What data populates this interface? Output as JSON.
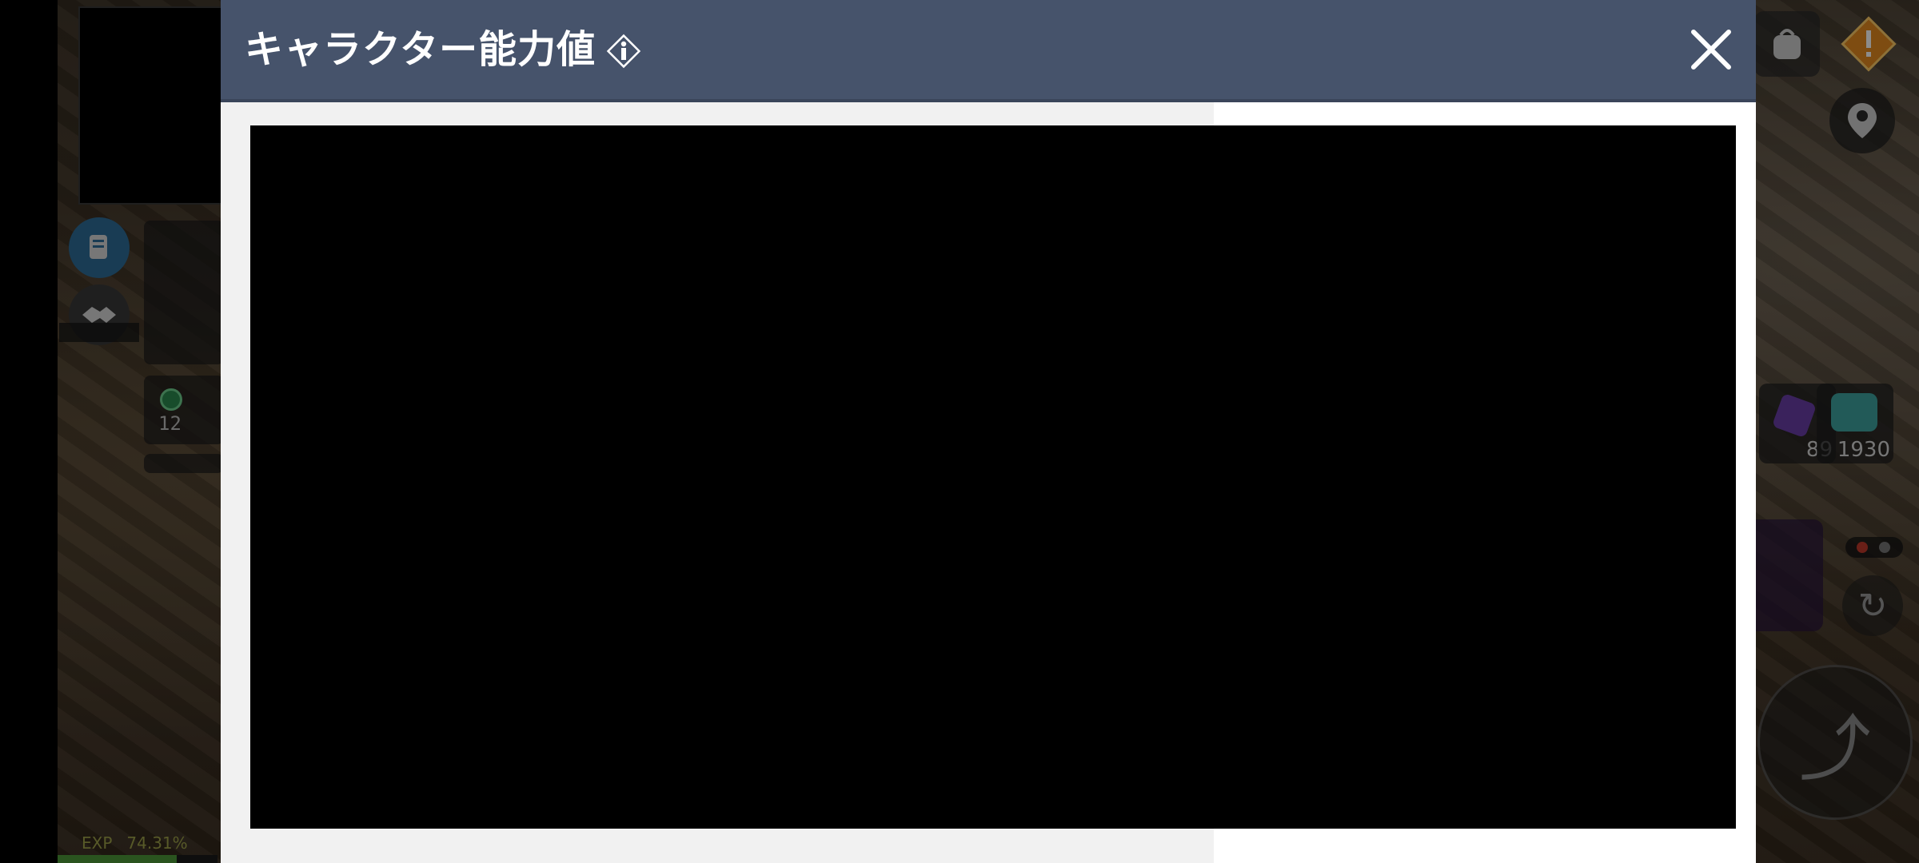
{
  "modal": {
    "title": "キャラクター能力値",
    "info_icon": "info-diamond-icon",
    "close_icon": "close-x-icon"
  },
  "hud": {
    "party": [
      {
        "level": "12"
      }
    ],
    "exp": {
      "label": "EXP",
      "percent_text": "74.31%",
      "progress": 0.7431
    },
    "items": [
      {
        "icon": "purple-crystal-icon",
        "count": "89"
      },
      {
        "icon": "potion-chest-icon",
        "count": "1930"
      }
    ],
    "icons": {
      "bag": "bag-icon",
      "warning": "warning-icon",
      "map_pin": "map-pin-icon",
      "quest": "scroll-icon",
      "friend": "handshake-icon",
      "refresh": "refresh-icon",
      "jump": "jump-arrow-icon"
    }
  },
  "colors": {
    "header": "#46536b",
    "content": "#000000",
    "warning": "#e58a1f"
  }
}
